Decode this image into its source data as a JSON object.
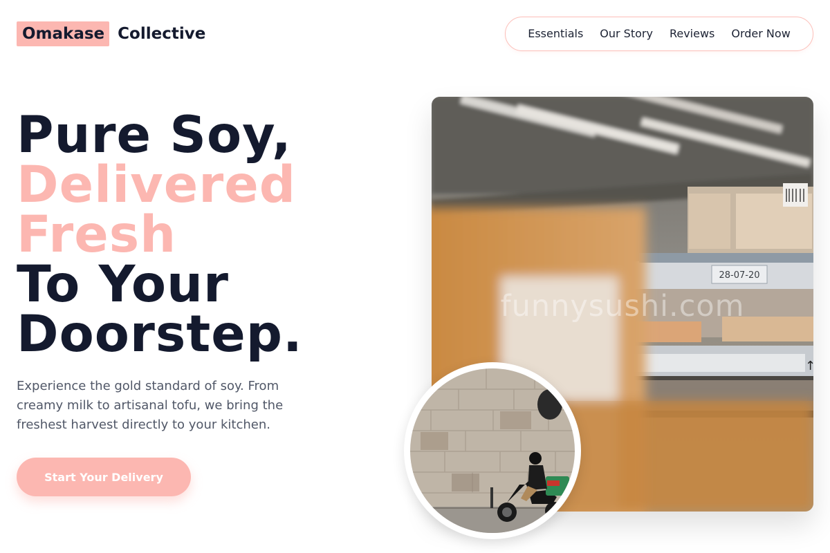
{
  "brand": {
    "highlight": "Omakase",
    "rest": "Collective"
  },
  "nav": {
    "items": [
      "Essentials",
      "Our Story",
      "Reviews",
      "Order Now"
    ]
  },
  "hero": {
    "line1": "Pure Soy,",
    "line2": "Delivered",
    "line3": "Fresh",
    "line4": "To Your",
    "line5": "Doorstep.",
    "subtitle": "Experience the gold standard of soy. From creamy milk to artisanal tofu, we bring the freshest harvest directly to your kitchen.",
    "cta": "Start Your Delivery"
  },
  "images": {
    "main": {
      "watermark": "funnysushi.com",
      "shelf_label": "28-07-20"
    }
  },
  "colors": {
    "accent": "#fcb7b1",
    "dark": "#141a2e",
    "muted": "#505767"
  }
}
